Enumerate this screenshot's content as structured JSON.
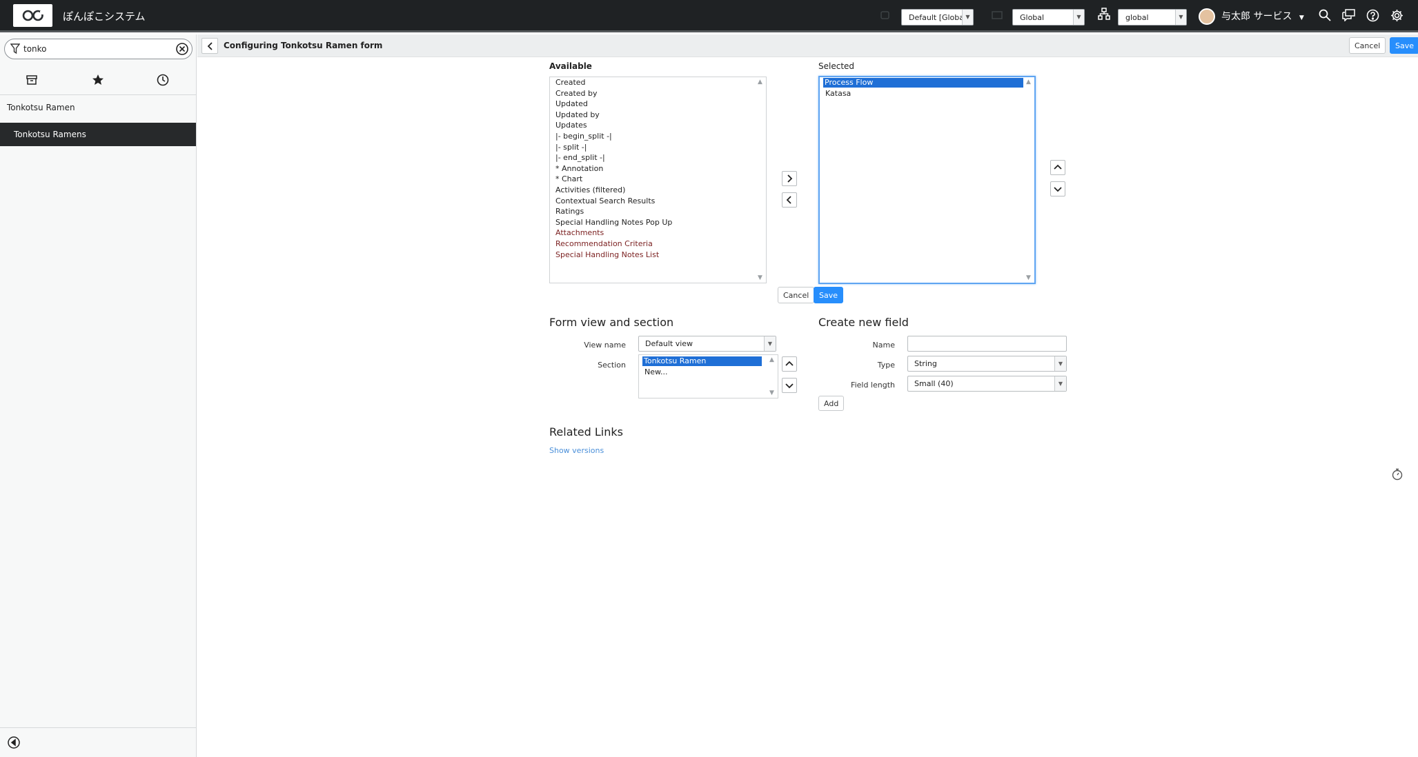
{
  "app": {
    "title": "ぽんぽこシステム",
    "logo_icon": "servicenow-logo"
  },
  "topbar": {
    "update_set": "Default [Global]",
    "application_scope": "Global",
    "domain": "global",
    "user_name": "与太郎 サービス",
    "icons": [
      "search-icon",
      "chat-icon",
      "help-icon",
      "gear-icon"
    ]
  },
  "sidebar": {
    "filter_value": "tonko",
    "module": "Tonkotsu Ramen",
    "items": [
      {
        "label": "Tonkotsu Ramens",
        "active": true
      }
    ]
  },
  "header": {
    "title": "Configuring Tonkotsu Ramen form",
    "cancel_label": "Cancel",
    "save_label": "Save"
  },
  "slushbucket": {
    "available_label": "Available",
    "selected_label": "Selected",
    "available": [
      {
        "text": "Created",
        "style": "normal"
      },
      {
        "text": "Created by",
        "style": "normal"
      },
      {
        "text": "Updated",
        "style": "normal"
      },
      {
        "text": "Updated by",
        "style": "normal"
      },
      {
        "text": "Updates",
        "style": "normal"
      },
      {
        "text": "|- begin_split -|",
        "style": "normal"
      },
      {
        "text": "|- split -|",
        "style": "normal"
      },
      {
        "text": "|- end_split -|",
        "style": "normal"
      },
      {
        "text": "* Annotation",
        "style": "normal"
      },
      {
        "text": "* Chart",
        "style": "normal"
      },
      {
        "text": "Activities (filtered)",
        "style": "normal"
      },
      {
        "text": "Contextual Search Results",
        "style": "normal"
      },
      {
        "text": "Ratings",
        "style": "normal"
      },
      {
        "text": "Special Handling Notes Pop Up",
        "style": "normal"
      },
      {
        "text": "Attachments",
        "style": "dark-red"
      },
      {
        "text": "Recommendation Criteria",
        "style": "dark-red"
      },
      {
        "text": "Special Handling Notes List",
        "style": "dark-red"
      }
    ],
    "selected": [
      {
        "text": "Process Flow",
        "selected": true
      },
      {
        "text": "Katasa",
        "selected": false
      }
    ],
    "cancel_label": "Cancel",
    "save_label": "Save"
  },
  "form_view": {
    "heading": "Form view and section",
    "view_name_label": "View name",
    "view_name_value": "Default view",
    "section_label": "Section",
    "sections": [
      {
        "text": "Tonkotsu Ramen",
        "selected": true
      },
      {
        "text": "New...",
        "selected": false
      }
    ]
  },
  "create_field": {
    "heading": "Create new field",
    "name_label": "Name",
    "name_value": "",
    "type_label": "Type",
    "type_value": "String",
    "length_label": "Field length",
    "length_value": "Small (40)",
    "add_label": "Add"
  },
  "related_links": {
    "heading": "Related Links",
    "show_versions": "Show versions"
  }
}
